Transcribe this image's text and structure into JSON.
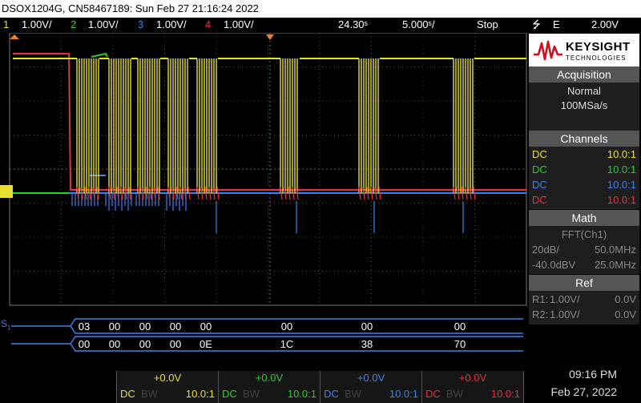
{
  "title": "DSOX1204G, CN58467189: Sun Feb 27 21:16:24 2022",
  "status": {
    "channels": [
      {
        "num": "1",
        "scale": "1.00V/",
        "color": "#e8e030"
      },
      {
        "num": "2",
        "scale": "1.00V/",
        "color": "#28d028"
      },
      {
        "num": "3",
        "scale": "1.00V/",
        "color": "#3a82ee"
      },
      {
        "num": "4",
        "scale": "1.00V/",
        "color": "#e83040"
      }
    ],
    "delay": "24.30ˢ",
    "timebase": "5.000ˢ/",
    "run_state": "Stop",
    "trigger_icon": "trigger-edge-icon",
    "trigger_slope": "⭍",
    "trigger_source": "E",
    "trigger_level": "2.00V"
  },
  "brand": {
    "name": "KEYSIGHT",
    "sub": "TECHNOLOGIES",
    "color": "#d0101e"
  },
  "acquisition": {
    "title": "Acquisition",
    "mode": "Normal",
    "rate": "100MSa/s"
  },
  "channels_panel": {
    "title": "Channels",
    "rows": [
      {
        "coupling": "DC",
        "probe": "10.0:1",
        "color": "#e8e030"
      },
      {
        "coupling": "DC",
        "probe": "10.0:1",
        "color": "#28d028"
      },
      {
        "coupling": "DC",
        "probe": "10.0:1",
        "color": "#3a82ee"
      },
      {
        "coupling": "DC",
        "probe": "10.0:1",
        "color": "#e83040"
      }
    ]
  },
  "math": {
    "title": "Math",
    "function": "FFT(Ch1)",
    "scale": "20dB/",
    "span": "50.0MHz",
    "ref": "-40.0dBV",
    "center": "25.0MHz"
  },
  "ref": {
    "title": "Ref",
    "r1_label": "R1:",
    "r1_scale": "1.00V/",
    "r1_offset": "0.0V",
    "r2_label": "R2:",
    "r2_scale": "1.00V/",
    "r2_offset": "0.0V"
  },
  "serial": {
    "marker": "S",
    "marker_sub": "1",
    "row1": [
      "03",
      "00",
      "00",
      "00",
      "00",
      "00",
      "00",
      "00"
    ],
    "row2": [
      "00",
      "00",
      "00",
      "00",
      "0E",
      "1C",
      "38",
      "70"
    ]
  },
  "bottom": {
    "offsets": [
      "+0.0V",
      "+0.0V",
      "+0.0V",
      "+0.0V"
    ],
    "coupling": "DC",
    "bw": "BW",
    "probe": "10.0:1",
    "time": "09:16 PM",
    "date": "Feb 27, 2022"
  }
}
